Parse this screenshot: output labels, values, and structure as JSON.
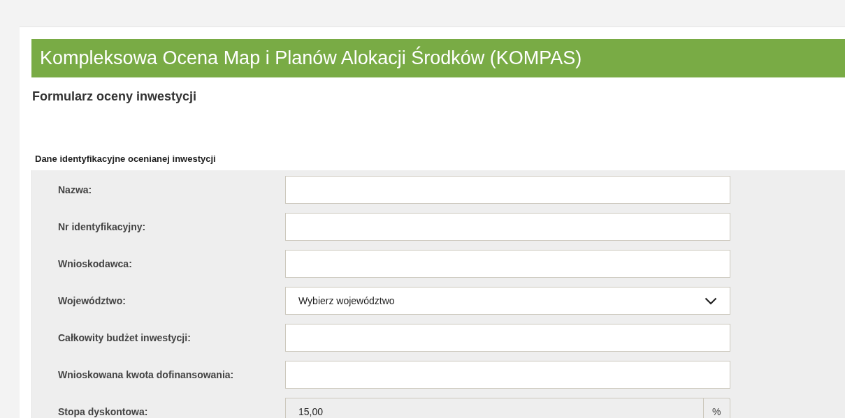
{
  "header": {
    "title": "Kompleksowa Ocena Map i Planów Alokacji Środków (KOMPAS)"
  },
  "subtitle": "Formularz oceny inwestycji",
  "section": {
    "title": "Dane identyfikacyjne ocenianej inwestycji",
    "fields": [
      {
        "kind": "text",
        "label": "Nazwa:"
      },
      {
        "kind": "text",
        "label": "Nr identyfikacyjny:"
      },
      {
        "kind": "text",
        "label": "Wnioskodawca:"
      },
      {
        "kind": "select",
        "label": "Województwo:",
        "value": "Wybierz województwo"
      },
      {
        "kind": "text",
        "label": "Całkowity budżet inwestycji:"
      },
      {
        "kind": "text",
        "label": "Wnioskowana kwota dofinansowania:"
      },
      {
        "kind": "addon",
        "label": "Stopa dyskontowa:",
        "value": "15,00",
        "unit": "%",
        "disabled": true
      }
    ]
  }
}
